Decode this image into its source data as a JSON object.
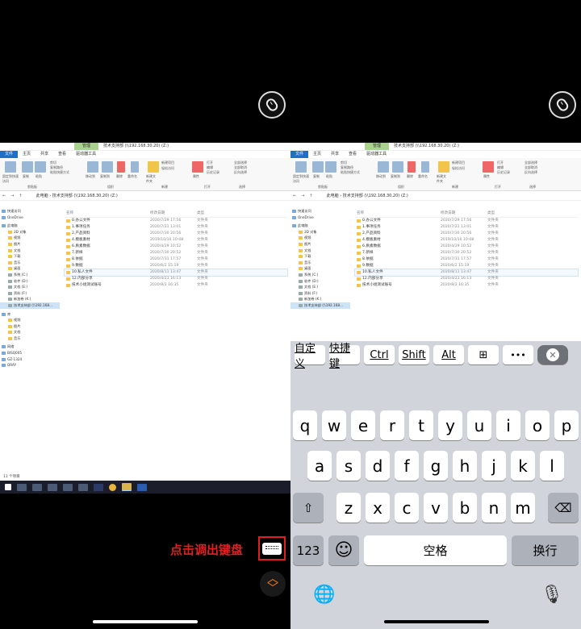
{
  "left": {
    "explorer": {
      "ctx_tab": "管理",
      "title": "技术支持部 (\\\\192.168.30.20) (Z:)",
      "tabs": [
        "文件",
        "主页",
        "共享",
        "查看",
        "驱动器工具"
      ],
      "ribbon": {
        "pin_label": "固定到快速访问",
        "copy_label": "复制",
        "paste_label": "粘贴",
        "cut_label": "剪切",
        "copy_path_label": "复制路径",
        "paste_shortcut_label": "粘贴快捷方式",
        "move_label": "移动到",
        "copyto_label": "复制到",
        "delete_label": "删除",
        "rename_label": "重命名",
        "newfolder_label": "新建文件夹",
        "newitem_label": "新建项目",
        "easyaccess_label": "轻松访问",
        "props_label": "属性",
        "open_label": "打开",
        "edit_label": "编辑",
        "history_label": "历史记录",
        "selall_label": "全部选择",
        "selnone_label": "全部取消",
        "selinv_label": "反向选择",
        "group_clipboard": "剪贴板",
        "group_organize": "组织",
        "group_new": "新建",
        "group_open": "打开",
        "group_select": "选择"
      },
      "address": "此电脑 › 技术支持部 (\\\\192.168.30.20) (Z:)",
      "nav": [
        {
          "label": "快速访问",
          "type": "star"
        },
        {
          "label": "OneDrive",
          "type": "cloud"
        },
        {
          "label": "此电脑",
          "type": "pc"
        },
        {
          "label": "3D 对象",
          "type": "fold"
        },
        {
          "label": "视频",
          "type": "fold"
        },
        {
          "label": "图片",
          "type": "fold"
        },
        {
          "label": "文档",
          "type": "fold"
        },
        {
          "label": "下载",
          "type": "fold"
        },
        {
          "label": "音乐",
          "type": "fold"
        },
        {
          "label": "桌面",
          "type": "fold"
        },
        {
          "label": "系统 (C:)",
          "type": "drv"
        },
        {
          "label": "软件 (D:)",
          "type": "drv"
        },
        {
          "label": "文档 (E:)",
          "type": "drv"
        },
        {
          "label": "资料 (F:)",
          "type": "drv"
        },
        {
          "label": "新加卷 (K:)",
          "type": "drv"
        },
        {
          "label": "技术支持部 (\\\\192.168...",
          "type": "drv",
          "selected": true
        },
        {
          "label": "库",
          "type": "lib"
        },
        {
          "label": "视频",
          "type": "fold"
        },
        {
          "label": "图片",
          "type": "fold"
        },
        {
          "label": "文档",
          "type": "fold"
        },
        {
          "label": "音乐",
          "type": "fold"
        },
        {
          "label": "网络",
          "type": "net"
        },
        {
          "label": "BISQ005",
          "type": "pc"
        },
        {
          "label": "GZ-1324",
          "type": "pc"
        },
        {
          "label": "ORAY",
          "type": "pc"
        }
      ],
      "columns": {
        "name": "名称",
        "date": "修改日期",
        "type": "类型"
      },
      "files": [
        {
          "name": "0.办公文件",
          "date": "2020/7/29 17:56",
          "type": "文件夹"
        },
        {
          "name": "1.事项任务",
          "date": "2020/7/21 13:01",
          "type": "文件夹"
        },
        {
          "name": "2.产品资料",
          "date": "2020/7/30 20:56",
          "type": "文件夹"
        },
        {
          "name": "4.模板素材",
          "date": "2019/10/10 10:08",
          "type": "文件夹"
        },
        {
          "name": "6.质素数据",
          "date": "2020/4/29 10:52",
          "type": "文件夹"
        },
        {
          "name": "7.新样",
          "date": "2020/7/30 20:52",
          "type": "文件夹"
        },
        {
          "name": "8.依据",
          "date": "2020/7/31 17:57",
          "type": "文件夹"
        },
        {
          "name": "9.数据",
          "date": "2020/6/2 15:19",
          "type": "文件夹"
        },
        {
          "name": "10.私人文件",
          "date": "2020/8/11 13:47",
          "type": "文件夹",
          "selected": true
        },
        {
          "name": "12.内部分享",
          "date": "2020/4/23 16:13",
          "type": "文件夹"
        },
        {
          "name": "技术小组测试账号",
          "date": "2020/8/2 16:35",
          "type": "文件夹"
        }
      ],
      "status": "11 个项目"
    },
    "hint": "点击调出键盘"
  },
  "right": {
    "keyboard": {
      "toolbar": [
        "自定义",
        "快捷键",
        "Ctrl",
        "Shift",
        "Alt",
        "⊞",
        "•••",
        "✕"
      ],
      "row1": [
        "q",
        "w",
        "e",
        "r",
        "t",
        "y",
        "u",
        "i",
        "o",
        "p"
      ],
      "row2": [
        "a",
        "s",
        "d",
        "f",
        "g",
        "h",
        "j",
        "k",
        "l"
      ],
      "row3": [
        "z",
        "x",
        "c",
        "v",
        "b",
        "n",
        "m"
      ],
      "num": "123",
      "emoji": "☺",
      "space": "空格",
      "return": "换行",
      "shift": "⇧",
      "backspace": "⌫",
      "globe": "🌐",
      "mic": "🎙"
    }
  },
  "colors": {
    "accent_red": "#e02020",
    "scroll_orange": "#f57a1e",
    "file_tab": "#1f6fc5",
    "ctx_tab": "#a8d28e"
  }
}
